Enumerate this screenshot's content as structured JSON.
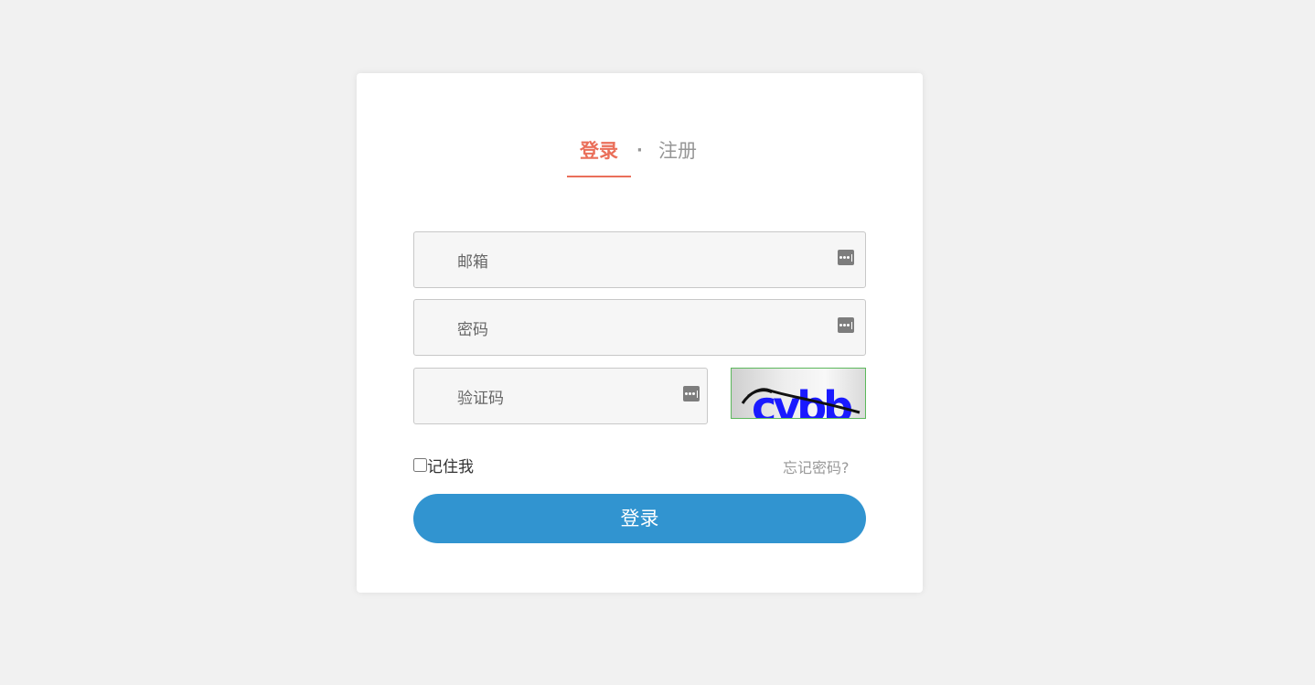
{
  "tabs": {
    "login": "登录",
    "separator": "·",
    "register": "注册"
  },
  "form": {
    "email_placeholder": "邮箱",
    "password_placeholder": "密码",
    "captcha_placeholder": "验证码",
    "captcha_text": "cvbb",
    "remember_label": "记住我",
    "forgot_link": "忘记密码?",
    "submit_label": "登录"
  },
  "icons": {
    "field_icon": "password-manager-icon"
  },
  "colors": {
    "accent": "#ea6f5a",
    "button": "#3194d0",
    "muted": "#969696",
    "captcha_text": "#1a1aff"
  }
}
